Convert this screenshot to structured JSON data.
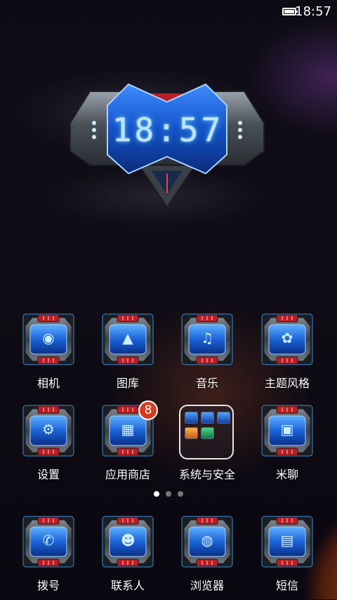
{
  "status_bar": {
    "time": "18:57"
  },
  "clock_widget": {
    "time": "18:57"
  },
  "apps_row1": [
    {
      "label": "相机",
      "icon": "camera-icon"
    },
    {
      "label": "图库",
      "icon": "gallery-icon"
    },
    {
      "label": "音乐",
      "icon": "music-icon"
    },
    {
      "label": "主题风格",
      "icon": "theme-icon"
    }
  ],
  "apps_row2": [
    {
      "label": "设置",
      "icon": "settings-icon"
    },
    {
      "label": "应用商店",
      "icon": "store-icon",
      "badge": "8"
    },
    {
      "label": "系统与安全",
      "icon": "folder-icon"
    },
    {
      "label": "米聊",
      "icon": "chat-icon"
    }
  ],
  "dock": [
    {
      "label": "拨号",
      "icon": "phone-icon"
    },
    {
      "label": "联系人",
      "icon": "contacts-icon"
    },
    {
      "label": "浏览器",
      "icon": "browser-icon"
    },
    {
      "label": "短信",
      "icon": "sms-icon"
    }
  ],
  "page_indicator": {
    "pages": 3,
    "current": 1
  },
  "colors": {
    "accent_blue": "#1e6fe0",
    "accent_red": "#c0222a",
    "badge": "#d93a1e"
  }
}
